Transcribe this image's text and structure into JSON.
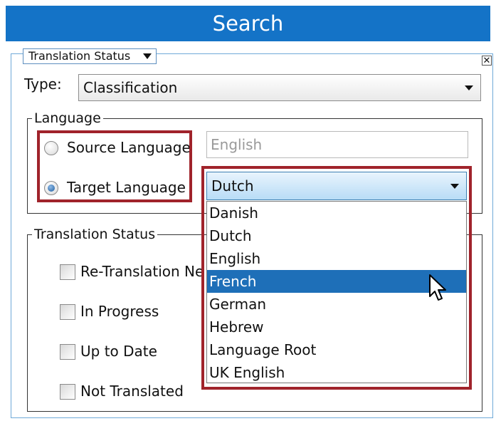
{
  "header": {
    "title": "Search"
  },
  "panel": {
    "tab_label": "Translation Status",
    "close_glyph": "✕"
  },
  "type_row": {
    "label": "Type:",
    "value": "Classification"
  },
  "language": {
    "legend": "Language",
    "source_label": "Source Language",
    "source_selected": false,
    "source_value": "English",
    "target_label": "Target Language",
    "target_selected": true,
    "target_value": "Dutch",
    "options": [
      {
        "label": "Danish",
        "highlighted": false
      },
      {
        "label": "Dutch",
        "highlighted": false
      },
      {
        "label": "English",
        "highlighted": false
      },
      {
        "label": "French",
        "highlighted": true
      },
      {
        "label": "German",
        "highlighted": false
      },
      {
        "label": "Hebrew",
        "highlighted": false
      },
      {
        "label": "Language Root",
        "highlighted": false
      },
      {
        "label": "UK English",
        "highlighted": false
      }
    ]
  },
  "translation_status": {
    "legend": "Translation Status",
    "items": [
      {
        "label": "Re-Translation Ne",
        "checked": false
      },
      {
        "label": "In Progress",
        "checked": false
      },
      {
        "label": "Up to Date",
        "checked": false
      },
      {
        "label": "Not Translated",
        "checked": false
      }
    ]
  },
  "colors": {
    "header_bg": "#1473c7",
    "highlight_bg": "#1e6fb8",
    "annotation_red": "#a0232b"
  }
}
